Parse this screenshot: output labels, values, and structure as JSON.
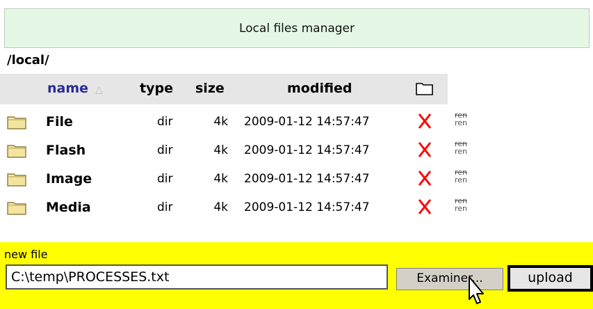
{
  "header": {
    "title": "Local files manager"
  },
  "path": "/local/",
  "columns": {
    "name": "name",
    "name_sort_arrow": "△",
    "type": "type",
    "size": "size",
    "modified": "modified"
  },
  "files": [
    {
      "name": "File",
      "type": "dir",
      "size": "4k",
      "modified": "2009-01-12 14:57:47",
      "ren_top": "ren",
      "ren_bottom": "ren"
    },
    {
      "name": "Flash",
      "type": "dir",
      "size": "4k",
      "modified": "2009-01-12 14:57:47",
      "ren_top": "ren",
      "ren_bottom": "ren"
    },
    {
      "name": "Image",
      "type": "dir",
      "size": "4k",
      "modified": "2009-01-12 14:57:47",
      "ren_top": "ren",
      "ren_bottom": "ren"
    },
    {
      "name": "Media",
      "type": "dir",
      "size": "4k",
      "modified": "2009-01-12 14:57:47",
      "ren_top": "ren",
      "ren_bottom": "ren"
    }
  ],
  "upload_form": {
    "label": "new file",
    "file_value": "C:\\temp\\PROCESSES.txt",
    "browse_label": "Examiner...",
    "upload_label": "upload"
  },
  "colors": {
    "header_bg": "#e5f7e5",
    "column_header_bg": "#e6e6e6",
    "form_bg": "#ffff00",
    "delete_red": "#ff0000",
    "folder_yellow": "#f3e4a0"
  },
  "icons": {
    "folder": "folder-icon",
    "delete": "delete-icon",
    "new_folder": "new-folder-icon",
    "cursor": "mouse-cursor-icon"
  }
}
